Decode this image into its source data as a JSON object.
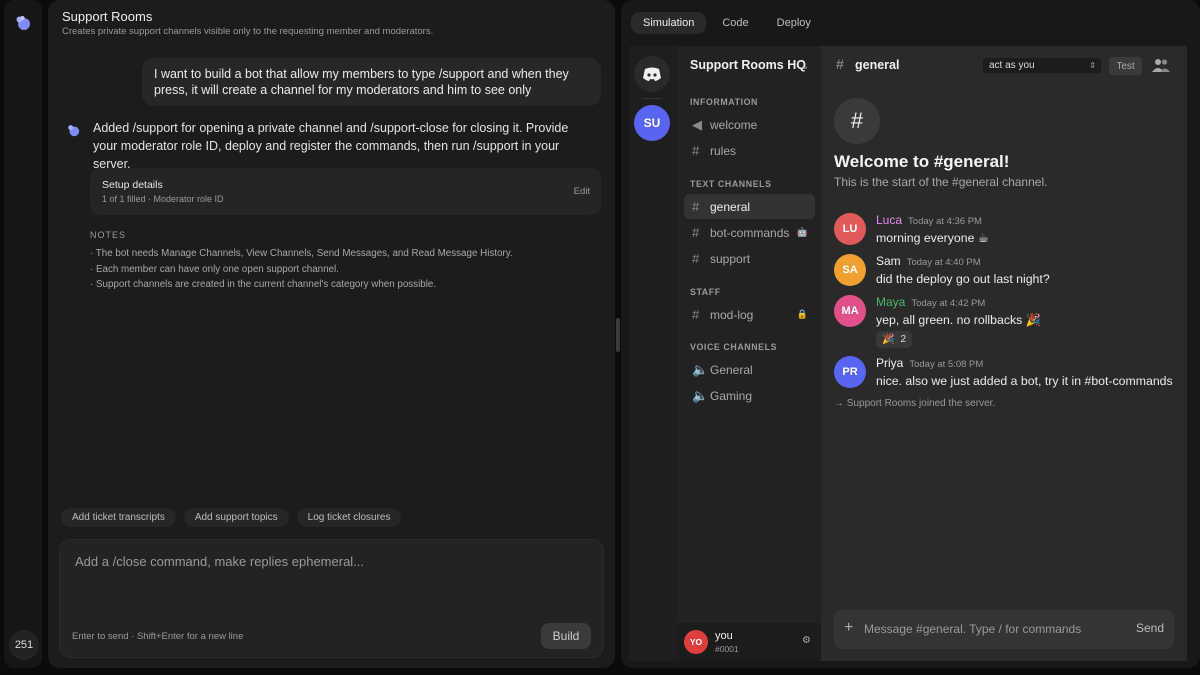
{
  "rail": {
    "usage_count": "251"
  },
  "chat": {
    "title": "Support Rooms",
    "subtitle": "Creates private support channels visible only to the requesting member and moderators.",
    "user_message": "I want to build a bot that allow my members to type /support and when they press, it will create a channel for my moderators and him to see only",
    "bot_message": "Added /support for opening a private channel and /support-close for closing it. Provide your moderator role ID, deploy and register the commands, then run /support in your server.",
    "setup": {
      "title": "Setup details",
      "status": "1 of 1 filled · Moderator role ID",
      "edit_label": "Edit"
    },
    "notes_heading": "NOTES",
    "notes": [
      "· The bot needs Manage Channels, View Channels, Send Messages, and Read Message History.",
      "· Each member can have only one open support channel.",
      "· Support channels are created in the current channel's category when possible."
    ],
    "suggestions": [
      "Add ticket transcripts",
      "Add support topics",
      "Log ticket closures"
    ],
    "composer": {
      "placeholder": "Add a /close command, make replies ephemeral...",
      "hint": "Enter to send · Shift+Enter for a new line",
      "build_label": "Build"
    }
  },
  "tabs": [
    "Simulation",
    "Code",
    "Deploy"
  ],
  "discord": {
    "server_badge": "SU",
    "server_name": "Support Rooms HQ",
    "categories": {
      "information": "INFORMATION",
      "text": "TEXT CHANNELS",
      "staff": "STAFF",
      "voice": "VOICE CHANNELS"
    },
    "channels": {
      "welcome": "welcome",
      "rules": "rules",
      "general": "general",
      "bot_commands": "bot-commands",
      "support": "support",
      "mod_log": "mod-log",
      "voice_general": "General",
      "voice_gaming": "Gaming"
    },
    "user": {
      "initials": "YO",
      "name": "you",
      "tag": "#0001"
    },
    "header": {
      "channel": "general",
      "act_as": "act as you",
      "test_label": "Test"
    },
    "welcome": {
      "title": "Welcome to #general!",
      "subtitle": "This is the start of the #general channel."
    },
    "messages": [
      {
        "initials": "LU",
        "name": "Luca",
        "time": "Today at 4:36 PM",
        "text": "morning everyone ☕",
        "color": "#e05a5a",
        "name_color": "#e48ae8"
      },
      {
        "initials": "SA",
        "name": "Sam",
        "time": "Today at 4:40 PM",
        "text": "did the deploy go out last night?",
        "color": "#f0a030",
        "name_color": "#f0f0f0"
      },
      {
        "initials": "MA",
        "name": "Maya",
        "time": "Today at 4:42 PM",
        "text": "yep, all green. no rollbacks 🎉",
        "color": "#e0508a",
        "name_color": "#4cb86a",
        "reaction": {
          "emoji": "🎉",
          "count": "2"
        }
      },
      {
        "initials": "PR",
        "name": "Priya",
        "time": "Today at 5:08 PM",
        "text": "nice. also we just added a bot, try it in #bot-commands",
        "color": "#5865f2",
        "name_color": "#f0f0f0"
      }
    ],
    "joined_notice": "→ Support Rooms joined the server.",
    "composer": {
      "placeholder": "Message #general. Type / for commands",
      "send_label": "Send"
    }
  }
}
